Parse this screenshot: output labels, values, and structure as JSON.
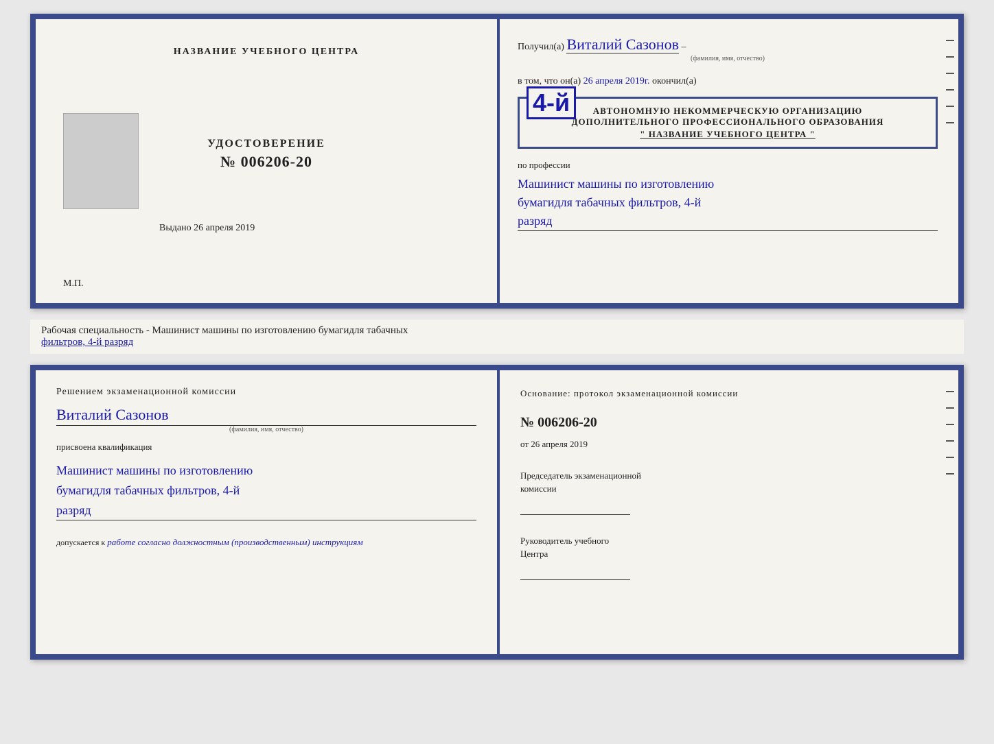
{
  "top_cert": {
    "left": {
      "title": "НАЗВАНИЕ УЧЕБНОГО ЦЕНТРА",
      "udostoverenie_label": "УДОСТОВЕРЕНИЕ",
      "number": "№ 006206-20",
      "vydano_label": "Выдано",
      "vydano_date": "26 апреля 2019",
      "mp_label": "М.П."
    },
    "right": {
      "poluchil_label": "Получил(а)",
      "poluchil_name": "Виталий Сазонов",
      "poluchil_subtitle": "(фамилия, имя, отчество)",
      "vtom_label": "в том, что он(а)",
      "vtom_date": "26 апреля 2019г.",
      "okonchil_label": "окончил(а)",
      "razryad_num": "4-й",
      "stamp_line1": "АВТОНОМНУЮ НЕКОММЕРЧЕСКУЮ ОРГАНИЗАЦИЮ",
      "stamp_line2": "ДОПОЛНИТЕЛЬНОГО ПРОФЕССИОНАЛЬНОГО ОБРАЗОВАНИЯ",
      "stamp_line3": "\" НАЗВАНИЕ УЧЕБНОГО ЦЕНТРА \"",
      "po_professii_label": "по профессии",
      "profession_line1": "Машинист машины по изготовлению",
      "profession_line2": "бумагидля табачных фильтров, 4-й",
      "profession_line3": "разряд"
    }
  },
  "middle": {
    "text_prefix": "Рабочая специальность - Машинист машины по изготовлению бумагидля табачных",
    "text_underlined": "фильтров, 4-й разряд"
  },
  "bottom_cert": {
    "left": {
      "resheniem_label": "Решением  экзаменационной  комиссии",
      "name": "Виталий Сазонов",
      "name_subtitle": "(фамилия, имя, отчество)",
      "prisvoyena_label": "присвоена квалификация",
      "profession_line1": "Машинист машины по изготовлению",
      "profession_line2": "бумагидля табачных фильтров, 4-й",
      "profession_line3": "разряд",
      "dopuskaetsya_label": "допускается к",
      "dopuskaetsya_value": "работе согласно должностным (производственным) инструкциям"
    },
    "right": {
      "osnov_label": "Основание: протокол экзаменационной  комиссии",
      "number": "№  006206-20",
      "ot_label": "от",
      "ot_date": "26 апреля 2019",
      "predsedatel_label": "Председатель экзаменационной",
      "predsedatel_label2": "комиссии",
      "rukov_label": "Руководитель учебного",
      "rukov_label2": "Центра"
    }
  }
}
